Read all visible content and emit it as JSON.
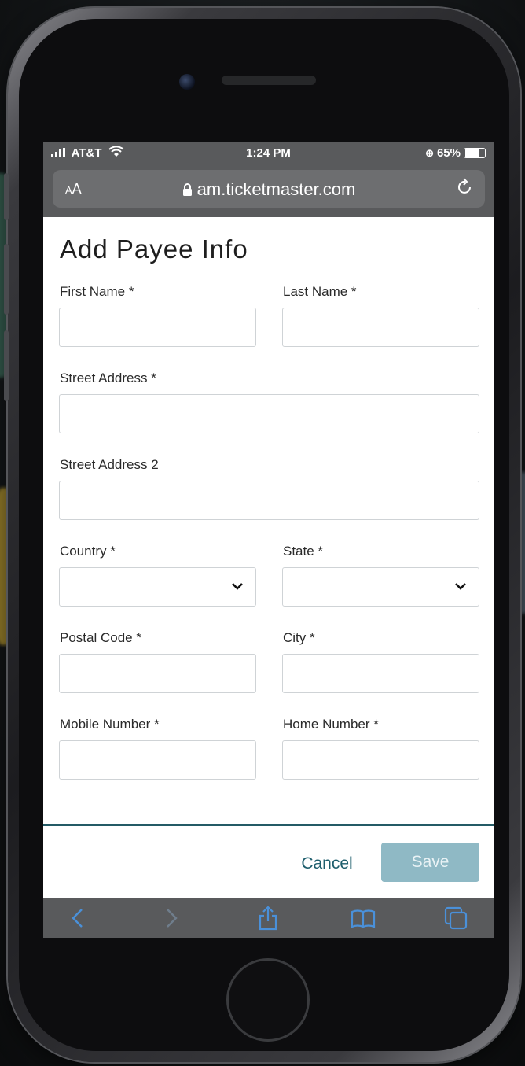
{
  "status_bar": {
    "carrier": "AT&T",
    "time": "1:24 PM",
    "battery": "65%",
    "battery_level": 0.65
  },
  "url_bar": {
    "text_size_label": "AA",
    "domain": "am.ticketmaster.com"
  },
  "form": {
    "title": "Add Payee Info",
    "fields": {
      "first_name": {
        "label": "First Name *",
        "value": ""
      },
      "last_name": {
        "label": "Last Name *",
        "value": ""
      },
      "street_address": {
        "label": "Street Address *",
        "value": ""
      },
      "street_address_2": {
        "label": "Street Address 2",
        "value": ""
      },
      "country": {
        "label": "Country *",
        "value": ""
      },
      "state": {
        "label": "State *",
        "value": ""
      },
      "postal_code": {
        "label": "Postal Code *",
        "value": ""
      },
      "city": {
        "label": "City *",
        "value": ""
      },
      "mobile_number": {
        "label": "Mobile Number *",
        "value": ""
      },
      "home_number": {
        "label": "Home Number *",
        "value": ""
      }
    }
  },
  "actions": {
    "cancel_label": "Cancel",
    "save_label": "Save"
  },
  "toolbar": {
    "icons": [
      "back-icon",
      "forward-icon",
      "share-icon",
      "bookmarks-icon",
      "tabs-icon"
    ]
  },
  "colors": {
    "accent": "#1d5d6c",
    "save_disabled": "#8fb9c5",
    "safari_chrome": "#595a5c",
    "toolbar_icon": "#4a90d9"
  }
}
